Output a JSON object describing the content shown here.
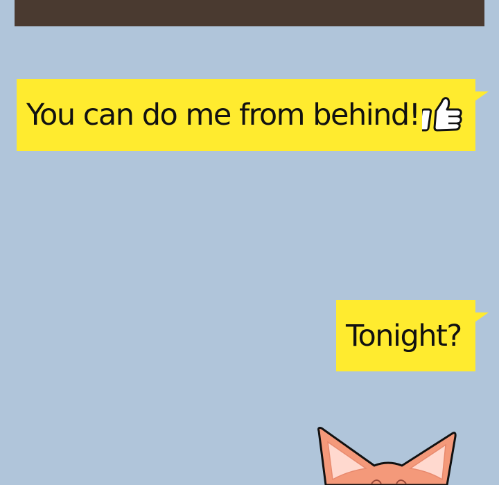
{
  "messages": [
    {
      "text": "You can do me from behind!",
      "icon": "thumbs-up-icon"
    },
    {
      "text": "Tonight?"
    }
  ],
  "colors": {
    "background": "#b0c5da",
    "bubble": "#ffeb2f",
    "top_bar": "#4a3a30",
    "cat_fur": "#f4997a"
  }
}
